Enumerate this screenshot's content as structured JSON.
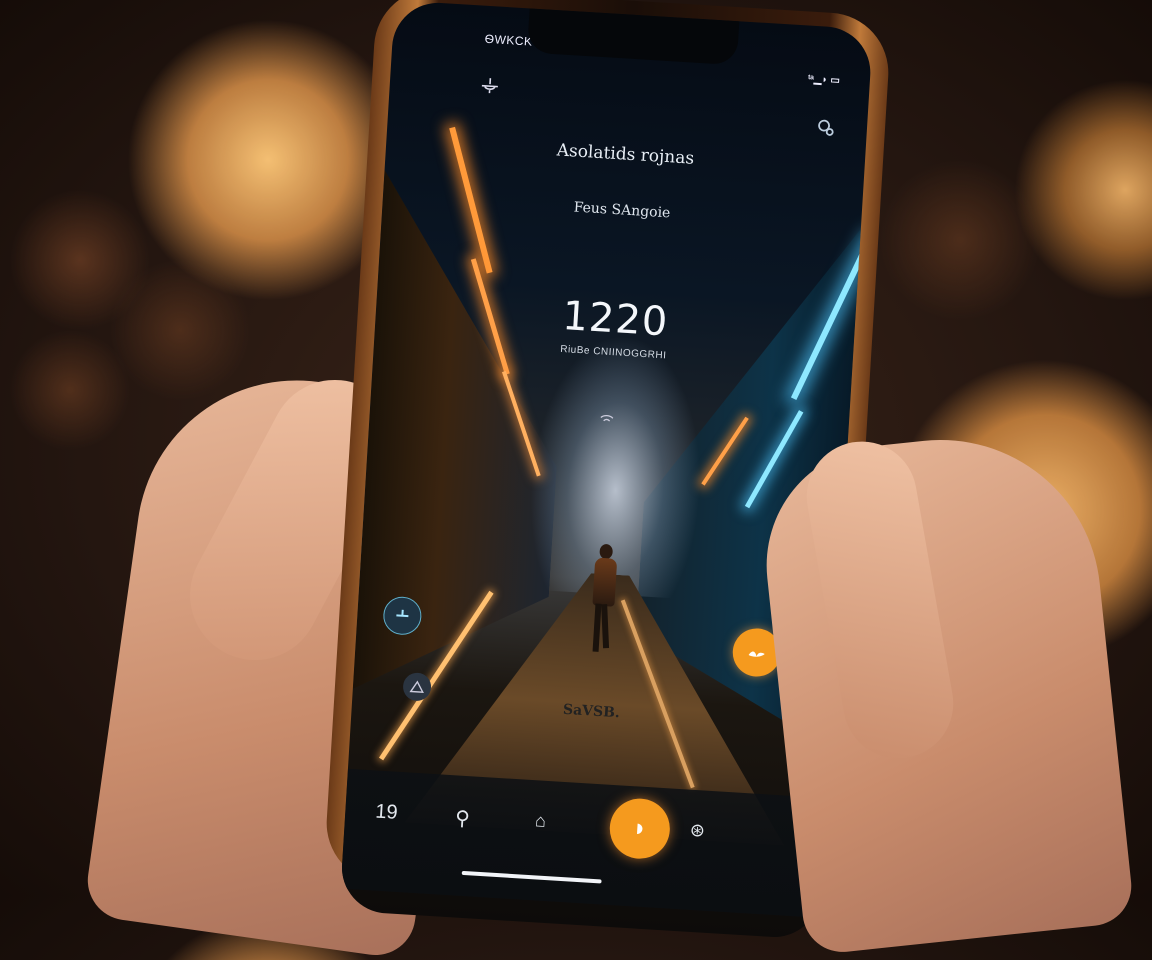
{
  "status_bar": {
    "left_text": "ѲWKCK",
    "right_text": "ᵗᵃ▁◗ ▭"
  },
  "screen": {
    "title": "Asolatids rojnas",
    "subtitle": "Feus SAngoie",
    "clock": "1220",
    "clock_caption": "RiuBe CNIINOGGRHI",
    "bottom_caption": "SaVSB."
  },
  "icons": {
    "top_left": "ceiling-fan-icon",
    "top_right": "settings-icon",
    "center_small": "signal-icon",
    "fab_left": "compass-icon",
    "fab_left_small": "shell-icon",
    "fab_right": "leaf-icon",
    "nav": [
      "number-19-icon",
      "location-pin-icon",
      "home-icon",
      "play-icon",
      "globe-icon"
    ]
  },
  "nav": {
    "items": [
      "19",
      "⚲",
      "⌂",
      "",
      "⊛"
    ],
    "fab_glyph": "◗"
  },
  "colors": {
    "accent_orange": "#f59a1e",
    "neon_orange": "#ff9a3a",
    "neon_cyan": "#8ee8ff"
  }
}
